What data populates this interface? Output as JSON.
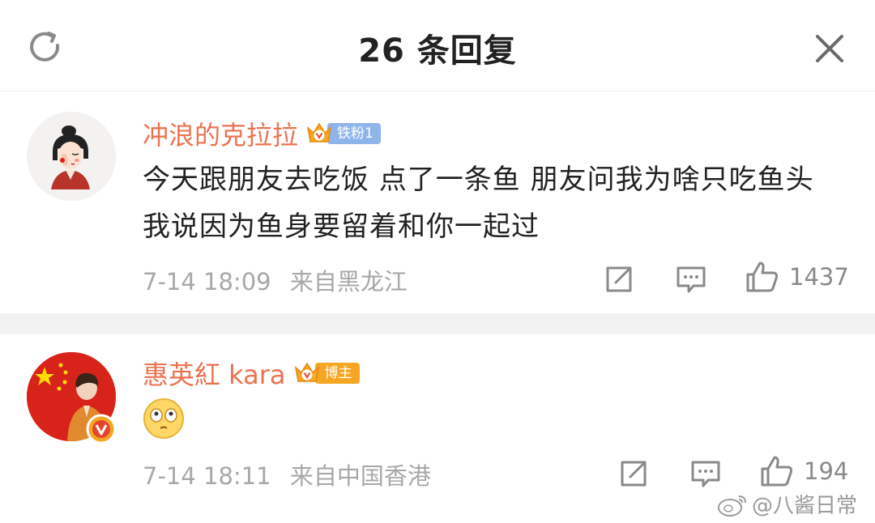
{
  "header": {
    "title": "26 条回复"
  },
  "comments": [
    {
      "username": "冲浪的克拉拉",
      "badge_label": "铁粉1",
      "text": "今天跟朋友去吃饭 点了一条鱼 朋友问我为啥只吃鱼头 我说因为鱼身要留着和你一起过",
      "time": "7-14 18:09",
      "source": "来自黑龙江",
      "likes": "1437"
    },
    {
      "username": "惠英紅 kara",
      "badge_label": "博主",
      "emoji": "flushed-face-emoji",
      "time": "7-14 18:11",
      "source": "来自中国香港",
      "likes": "194"
    }
  ],
  "watermark": {
    "text": "@八酱日常"
  },
  "colors": {
    "username": "#eb7350",
    "meta_gray": "#a8a8a8",
    "icon_gray": "#8a8a8a",
    "badge_blue": "#8fb4ea",
    "badge_orange": "#f5a623",
    "divider": "#f2f2f2"
  }
}
